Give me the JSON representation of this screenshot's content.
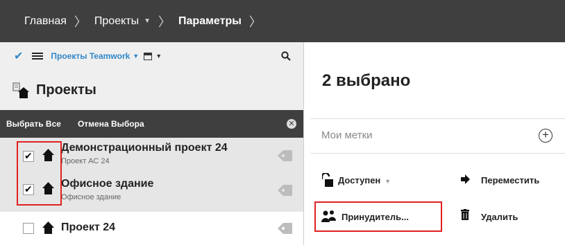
{
  "breadcrumb": {
    "items": [
      "Главная",
      "Проекты",
      "Параметры"
    ]
  },
  "toolbar": {
    "filter_label": "Проекты Teamwork"
  },
  "projects_panel": {
    "title": "Проекты",
    "select_all": "Выбрать Все",
    "cancel_selection": "Отмена Выбора",
    "items": [
      {
        "title": "Демонстрационный проект 24",
        "subtitle": "Проект АС 24",
        "checked": true
      },
      {
        "title": "Офисное здание",
        "subtitle": "Офисное здание",
        "checked": true
      },
      {
        "title": "Проект 24",
        "subtitle": "",
        "checked": false
      }
    ]
  },
  "details": {
    "selected_count": "2 выбрано",
    "tags_label": "Мои метки",
    "actions": {
      "available": "Доступен",
      "move": "Переместить",
      "force": "Принудитель...",
      "delete": "Удалить"
    }
  },
  "colors": {
    "accent": "#2f86c8",
    "dark_bar": "#3f3f3f",
    "highlight": "#e02020"
  }
}
